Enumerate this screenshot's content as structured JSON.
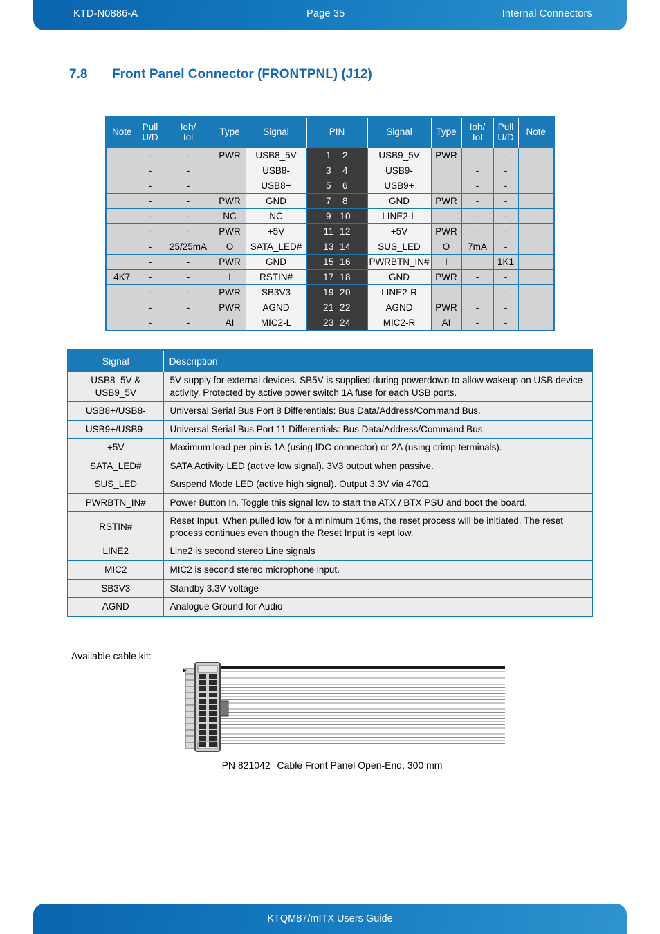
{
  "header": {
    "doc_id": "KTD-N0886-A",
    "page": "Page 35",
    "section": "Internal Connectors"
  },
  "footer": {
    "title": "KTQM87/mITX Users Guide"
  },
  "section": {
    "number": "7.8",
    "title": "Front Panel Connector (FRONTPNL) (J12)"
  },
  "pin_table": {
    "headers": {
      "note_left": "Note",
      "pull_left": "Pull\nU/D",
      "ioh_left": "Ioh/\nIol",
      "type_left": "Type",
      "signal_left": "Signal",
      "pin": "PIN",
      "signal_right": "Signal",
      "type_right": "Type",
      "ioh_right": "Ioh/\nIol",
      "pull_right": "Pull\nU/D",
      "note_right": "Note"
    },
    "rows": [
      {
        "note_l": "",
        "pull_l": "-",
        "ioh_l": "-",
        "type_l": "PWR",
        "sig_l": "USB8_5V",
        "pin_a": "1",
        "pin_b": "2",
        "sig_r": "USB9_5V",
        "type_r": "PWR",
        "ioh_r": "-",
        "pull_r": "-",
        "note_r": ""
      },
      {
        "note_l": "",
        "pull_l": "-",
        "ioh_l": "-",
        "type_l": "",
        "sig_l": "USB8-",
        "pin_a": "3",
        "pin_b": "4",
        "sig_r": "USB9-",
        "type_r": "",
        "ioh_r": "-",
        "pull_r": "-",
        "note_r": ""
      },
      {
        "note_l": "",
        "pull_l": "-",
        "ioh_l": "-",
        "type_l": "",
        "sig_l": "USB8+",
        "pin_a": "5",
        "pin_b": "6",
        "sig_r": "USB9+",
        "type_r": "",
        "ioh_r": "-",
        "pull_r": "-",
        "note_r": ""
      },
      {
        "note_l": "",
        "pull_l": "-",
        "ioh_l": "-",
        "type_l": "PWR",
        "sig_l": "GND",
        "pin_a": "7",
        "pin_b": "8",
        "sig_r": "GND",
        "type_r": "PWR",
        "ioh_r": "-",
        "pull_r": "-",
        "note_r": ""
      },
      {
        "note_l": "",
        "pull_l": "-",
        "ioh_l": "-",
        "type_l": "NC",
        "sig_l": "NC",
        "pin_a": "9",
        "pin_b": "10",
        "sig_r": "LINE2-L",
        "type_r": "",
        "ioh_r": "-",
        "pull_r": "-",
        "note_r": ""
      },
      {
        "note_l": "",
        "pull_l": "-",
        "ioh_l": "-",
        "type_l": "PWR",
        "sig_l": "+5V",
        "pin_a": "11",
        "pin_b": "12",
        "sig_r": "+5V",
        "type_r": "PWR",
        "ioh_r": "-",
        "pull_r": "-",
        "note_r": ""
      },
      {
        "note_l": "",
        "pull_l": "-",
        "ioh_l": "25/25mA",
        "type_l": "O",
        "sig_l": "SATA_LED#",
        "pin_a": "13",
        "pin_b": "14",
        "sig_r": "SUS_LED",
        "type_r": "O",
        "ioh_r": "7mA",
        "pull_r": "-",
        "note_r": ""
      },
      {
        "note_l": "",
        "pull_l": "-",
        "ioh_l": "-",
        "type_l": "PWR",
        "sig_l": "GND",
        "pin_a": "15",
        "pin_b": "16",
        "sig_r": "PWRBTN_IN#",
        "type_r": "I",
        "ioh_r": "",
        "pull_r": "1K1",
        "note_r": ""
      },
      {
        "note_l": "4K7",
        "pull_l": "-",
        "ioh_l": "-",
        "type_l": "I",
        "sig_l": "RSTIN#",
        "pin_a": "17",
        "pin_b": "18",
        "sig_r": "GND",
        "type_r": "PWR",
        "ioh_r": "-",
        "pull_r": "-",
        "note_r": ""
      },
      {
        "note_l": "",
        "pull_l": "-",
        "ioh_l": "-",
        "type_l": "PWR",
        "sig_l": "SB3V3",
        "pin_a": "19",
        "pin_b": "20",
        "sig_r": "LINE2-R",
        "type_r": "",
        "ioh_r": "-",
        "pull_r": "-",
        "note_r": ""
      },
      {
        "note_l": "",
        "pull_l": "-",
        "ioh_l": "-",
        "type_l": "PWR",
        "sig_l": "AGND",
        "pin_a": "21",
        "pin_b": "22",
        "sig_r": "AGND",
        "type_r": "PWR",
        "ioh_r": "-",
        "pull_r": "-",
        "note_r": ""
      },
      {
        "note_l": "",
        "pull_l": "-",
        "ioh_l": "-",
        "type_l": "AI",
        "sig_l": "MIC2-L",
        "pin_a": "23",
        "pin_b": "24",
        "sig_r": "MIC2-R",
        "type_r": "AI",
        "ioh_r": "-",
        "pull_r": "-",
        "note_r": ""
      }
    ]
  },
  "desc_table": {
    "headers": {
      "signal": "Signal",
      "description": "Description"
    },
    "rows": [
      {
        "signal": "USB8_5V &\nUSB9_5V",
        "description": "5V supply for external devices.  SB5V is supplied during powerdown to allow wakeup on USB device activity. Protected by active power switch 1A fuse for each USB ports."
      },
      {
        "signal": "USB8+/USB8-",
        "description": "Universal Serial Bus Port 8 Differentials: Bus Data/Address/Command Bus."
      },
      {
        "signal": "USB9+/USB9-",
        "description": "Universal Serial Bus Port 11 Differentials: Bus Data/Address/Command Bus."
      },
      {
        "signal": "+5V",
        "description": "Maximum load per pin is 1A (using IDC connector) or 2A (using crimp terminals)."
      },
      {
        "signal": "SATA_LED#",
        "description": "SATA Activity LED (active low signal). 3V3 output when passive."
      },
      {
        "signal": "SUS_LED",
        "description": "Suspend Mode LED (active high signal). Output 3.3V via 470Ω."
      },
      {
        "signal": "PWRBTN_IN#",
        "description": "Power Button In. Toggle this signal low to start the ATX / BTX PSU and boot the board."
      },
      {
        "signal": "RSTIN#",
        "description": "Reset Input. When pulled low for a minimum 16ms, the reset process will be initiated. The reset process continues even though the Reset Input is kept low."
      },
      {
        "signal": "LINE2",
        "description": "Line2 is second stereo Line signals"
      },
      {
        "signal": "MIC2",
        "description": "MIC2 is second stereo microphone input."
      },
      {
        "signal": "SB3V3",
        "description": "Standby 3.3V voltage"
      },
      {
        "signal": "AGND",
        "description": "Analogue Ground for Audio"
      }
    ]
  },
  "cable": {
    "label": "Available cable kit:",
    "caption_part_number": "PN 821042",
    "caption_text": "Cable Front Panel Open-End, 300 mm",
    "connector_rows": 12
  },
  "colors": {
    "brand_blue": "#1a7ab8",
    "header_blue_dark": "#0b64ad",
    "header_blue_light": "#2e93cf",
    "heading_blue": "#1569b0",
    "pin_column_dark": "#3b3b3b",
    "cell_gray": "#d3d3d3",
    "cell_light": "#f3f3f3",
    "desc_cell": "#ececec"
  }
}
